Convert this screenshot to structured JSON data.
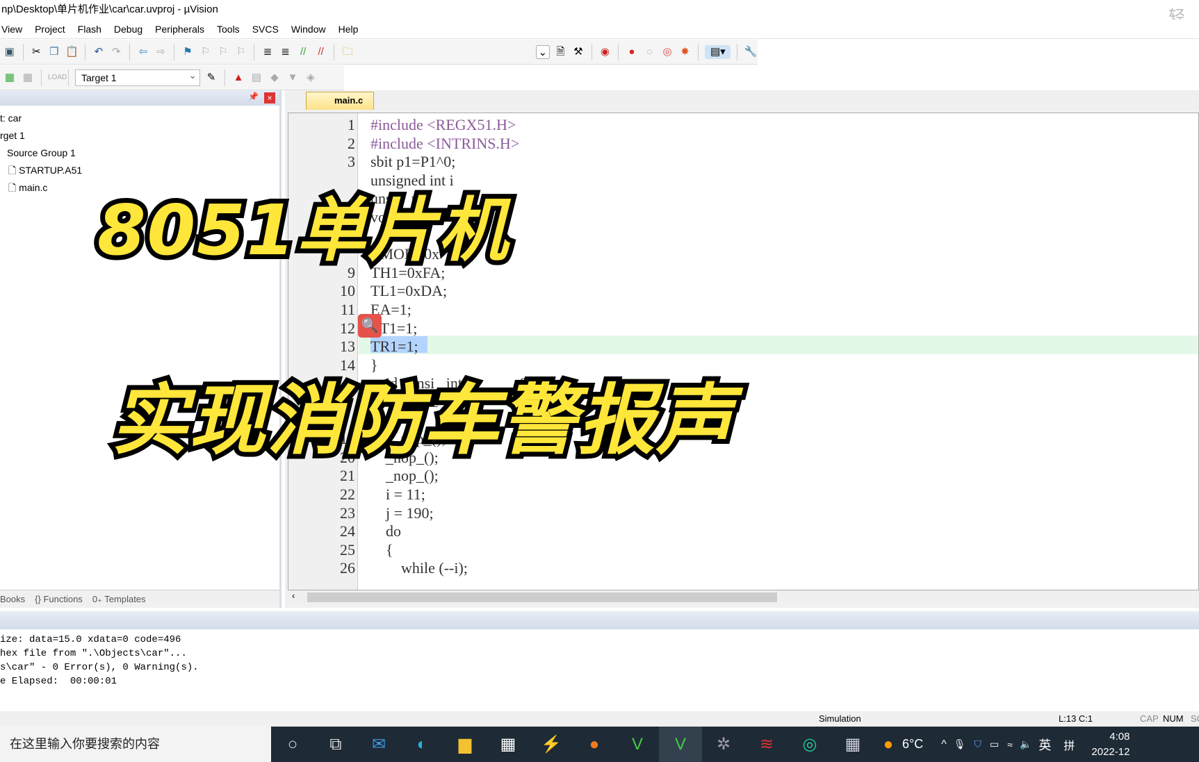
{
  "window_title": "np\\Desktop\\单片机作业\\car\\car.uvproj - µVision",
  "menu": [
    "View",
    "Project",
    "Flash",
    "Debug",
    "Peripherals",
    "Tools",
    "SVCS",
    "Window",
    "Help"
  ],
  "toolbar2": {
    "target": "Target 1"
  },
  "project": {
    "items": [
      "t: car",
      "rget 1",
      "Source Group 1",
      "STARTUP.A51",
      "main.c"
    ],
    "tabs": [
      "Books",
      "Functions",
      "Templates"
    ]
  },
  "editor": {
    "tab": "main.c",
    "lines": [
      {
        "n": "1",
        "t": "#include <REGX51.H>"
      },
      {
        "n": "2",
        "t": "#include <INTRINS.H>"
      },
      {
        "n": "3",
        "t": "sbit p1=P1^0;"
      },
      {
        "n": "",
        "t": "unsigned int i"
      },
      {
        "n": "",
        "t": "unsi    nt"
      },
      {
        "n": "",
        "t": "void   _in"
      },
      {
        "n": "",
        "t": ""
      },
      {
        "n": "",
        "t": "TMOD=0x"
      },
      {
        "n": "9",
        "t": "TH1=0xFA;"
      },
      {
        "n": "10",
        "t": "TL1=0xDA;"
      },
      {
        "n": "11",
        "t": "EA=1;"
      },
      {
        "n": "12",
        "t": "ET1=1;"
      },
      {
        "n": "13",
        "t": "TR1=1;"
      },
      {
        "n": "14",
        "t": "}"
      },
      {
        "n": "",
        "t": "void   unsi   int               050"
      },
      {
        "n": "",
        "t": "             d c    j;"
      },
      {
        "n": "",
        "t": "          e)"
      },
      {
        "n": "19",
        "t": "    {_nop_();"
      },
      {
        "n": "20",
        "t": "    _nop_();"
      },
      {
        "n": "21",
        "t": "    _nop_();"
      },
      {
        "n": "22",
        "t": "    i = 11;"
      },
      {
        "n": "23",
        "t": "    j = 190;"
      },
      {
        "n": "24",
        "t": "    do"
      },
      {
        "n": "25",
        "t": "    {"
      },
      {
        "n": "26",
        "t": "        while (--i);"
      }
    ]
  },
  "overlay": {
    "line1": "8051单片机",
    "line2": "实现消防车警报声"
  },
  "output": [
    "ize: data=15.0 xdata=0 code=496",
    "hex file from \".\\Objects\\car\"...",
    "s\\car\" - 0 Error(s), 0 Warning(s).",
    "e Elapsed:  00:00:01"
  ],
  "status": {
    "mode": "Simulation",
    "pos": "L:13 C:1",
    "cap": "CAP",
    "num": "NUM",
    "scrl": "SC"
  },
  "taskbar": {
    "search": "在这里输入你要搜索的内容",
    "weather": "6°C",
    "ime": "英",
    "ime2": "拼",
    "time": "4:08",
    "date": "2022-12"
  },
  "watermark": "轻",
  "colors": {
    "overlay_fill": "#ffe63a",
    "keyword": "#1f3fb0",
    "number": "#2a8a8a",
    "highlight": "#e4f8e8"
  }
}
